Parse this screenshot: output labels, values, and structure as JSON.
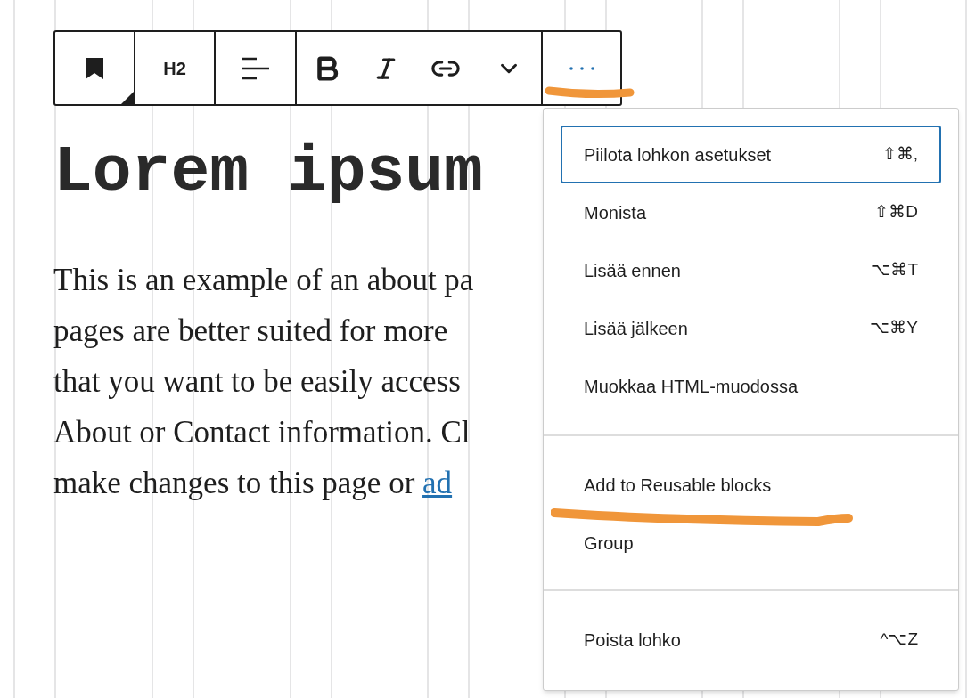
{
  "toolbar": {
    "groups": [
      {
        "buttons": [
          {
            "kind": "block-type"
          }
        ]
      },
      {
        "buttons": [
          {
            "kind": "text",
            "label": "H2"
          }
        ]
      },
      {
        "buttons": [
          {
            "kind": "align"
          }
        ]
      },
      {
        "buttons": [
          {
            "kind": "bold"
          },
          {
            "kind": "italic"
          },
          {
            "kind": "link"
          },
          {
            "kind": "chevron"
          }
        ]
      },
      {
        "buttons": [
          {
            "kind": "more",
            "expanded": true
          }
        ]
      }
    ]
  },
  "heading": "Lorem ipsum",
  "paragraph": {
    "lines": [
      {
        "text": "This is an example of an about pa"
      },
      {
        "text": "pages are better suited for more"
      },
      {
        "text": "that you want to be easily access"
      },
      {
        "text": "About or Contact information. Cl"
      },
      {
        "text": "make changes to this page or ",
        "link": "ad"
      }
    ]
  },
  "menu": {
    "sections": [
      {
        "items": [
          {
            "label": "Piilota lohkon asetukset",
            "shortcut": "⇧⌘,",
            "selected": true
          },
          {
            "label": "Monista",
            "shortcut": "⇧⌘D",
            "selected": false
          },
          {
            "label": "Lisää ennen",
            "shortcut": "⌥⌘T",
            "selected": false
          },
          {
            "label": "Lisää jälkeen",
            "shortcut": "⌥⌘Y",
            "selected": false
          },
          {
            "label": "Muokkaa HTML-muodossa",
            "selected": false
          }
        ]
      },
      {
        "items": [
          {
            "label": "Add to Reusable blocks",
            "selected": false
          },
          {
            "label": "Group",
            "selected": false
          }
        ]
      },
      {
        "items": [
          {
            "label": "Poista lohko",
            "shortcut": "^⌥Z",
            "selected": false
          }
        ]
      }
    ]
  }
}
